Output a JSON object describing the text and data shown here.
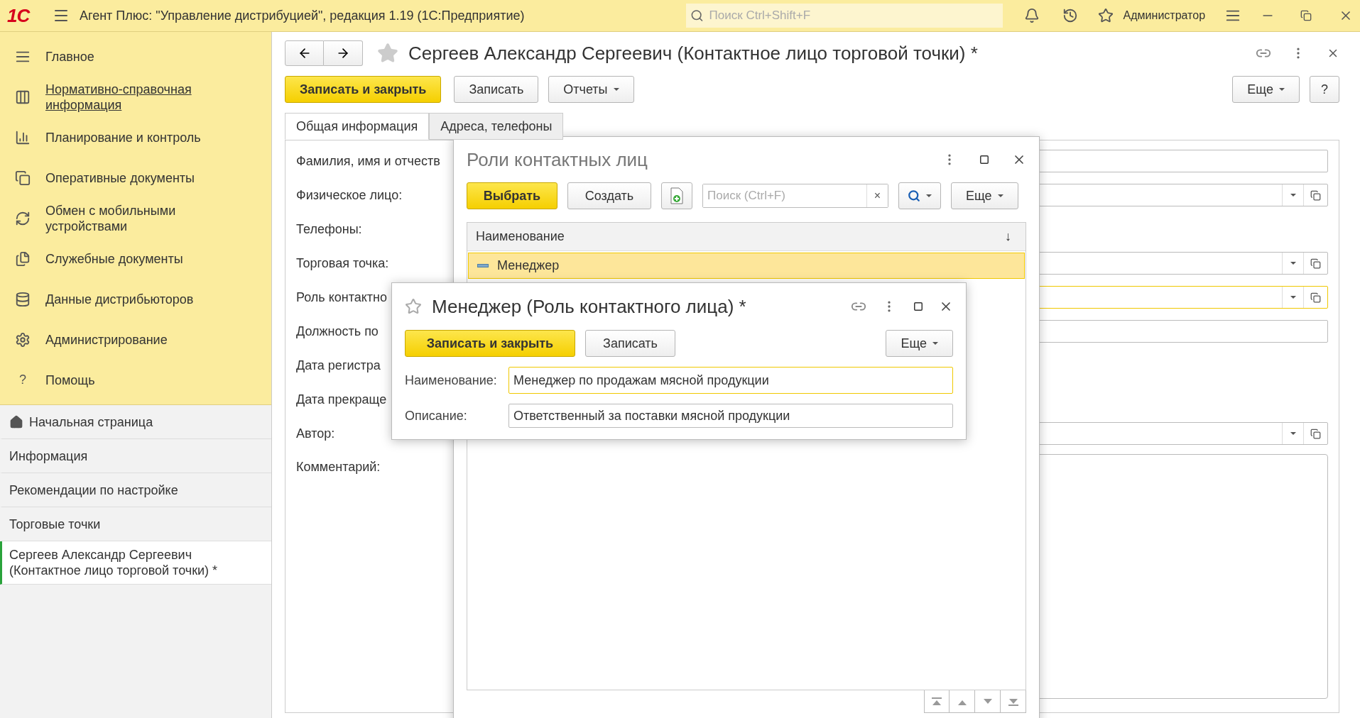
{
  "app_bar": {
    "logo": "1С",
    "title": "Агент Плюс: \"Управление дистрибуцией\", редакция 1.19  (1С:Предприятие)",
    "search": {
      "placeholder": "Поиск Ctrl+Shift+F"
    },
    "user": "Администратор"
  },
  "sections": [
    {
      "label": "Главное",
      "hovered": false
    },
    {
      "label": "Нормативно-справочная информация",
      "hovered": true
    },
    {
      "label": "Планирование и контроль",
      "hovered": false
    },
    {
      "label": "Оперативные документы",
      "hovered": false
    },
    {
      "label": "Обмен с мобильными устройствами",
      "hovered": false
    },
    {
      "label": "Служебные документы",
      "hovered": false
    },
    {
      "label": "Данные дистрибьюторов",
      "hovered": false
    },
    {
      "label": "Администрирование",
      "hovered": false
    },
    {
      "label": "Помощь",
      "hovered": false,
      "icon_char": "?"
    }
  ],
  "open_windows": [
    {
      "label": "Начальная страница",
      "selected": false
    },
    {
      "label": "Информация",
      "selected": false
    },
    {
      "label": "Рекомендации по настройке",
      "selected": false
    },
    {
      "label": "Торговые точки",
      "selected": false
    },
    {
      "label": "Сергеев Александр Сергеевич (Контактное лицо торговой точки) *",
      "selected": true
    }
  ],
  "form": {
    "title": "Сергеев Александр Сергеевич (Контактное лицо торговой точки) *",
    "save_close": "Записать и закрыть",
    "save": "Записать",
    "reports": "Отчеты",
    "more": "Еще",
    "help": "?",
    "tabs": [
      {
        "label": "Общая информация",
        "selected": true
      },
      {
        "label": "Адреса, телефоны",
        "selected": false
      }
    ],
    "fields": [
      {
        "label": "Фамилия, имя и отчеств",
        "kind": "input"
      },
      {
        "label": "Физическое лицо:",
        "kind": "dropdown"
      },
      {
        "label": "Телефоны:",
        "kind": "none"
      },
      {
        "label": "Торговая точка:",
        "kind": "dropdown"
      },
      {
        "label": "Роль контактно",
        "kind": "dropdown",
        "focused": true
      },
      {
        "label": "Должность по",
        "kind": "input"
      },
      {
        "label": "Дата регистра",
        "kind": "none"
      },
      {
        "label": "Дата прекраще",
        "kind": "none"
      },
      {
        "label": "Автор:",
        "kind": "dropdown"
      },
      {
        "label": "Комментарий:",
        "kind": "textarea"
      }
    ]
  },
  "roles_dialog": {
    "title": "Роли контактных лиц",
    "choose": "Выбрать",
    "create": "Создать",
    "search": {
      "placeholder": "Поиск (Ctrl+F)",
      "clear": "×"
    },
    "more": "Еще",
    "column": "Наименование",
    "sort": "↓",
    "rows": [
      {
        "name": "Менеджер",
        "selected": true
      }
    ]
  },
  "role_form": {
    "title": "Менеджер (Роль контактного лица) *",
    "save_close": "Записать и закрыть",
    "save": "Записать",
    "more": "Еще",
    "fields": [
      {
        "label": "Наименование:",
        "value": "Менеджер по продажам мясной продукции",
        "focused": true
      },
      {
        "label": "Описание:",
        "value": "Ответственный за поставки мясной продукции",
        "focused": false
      }
    ]
  }
}
